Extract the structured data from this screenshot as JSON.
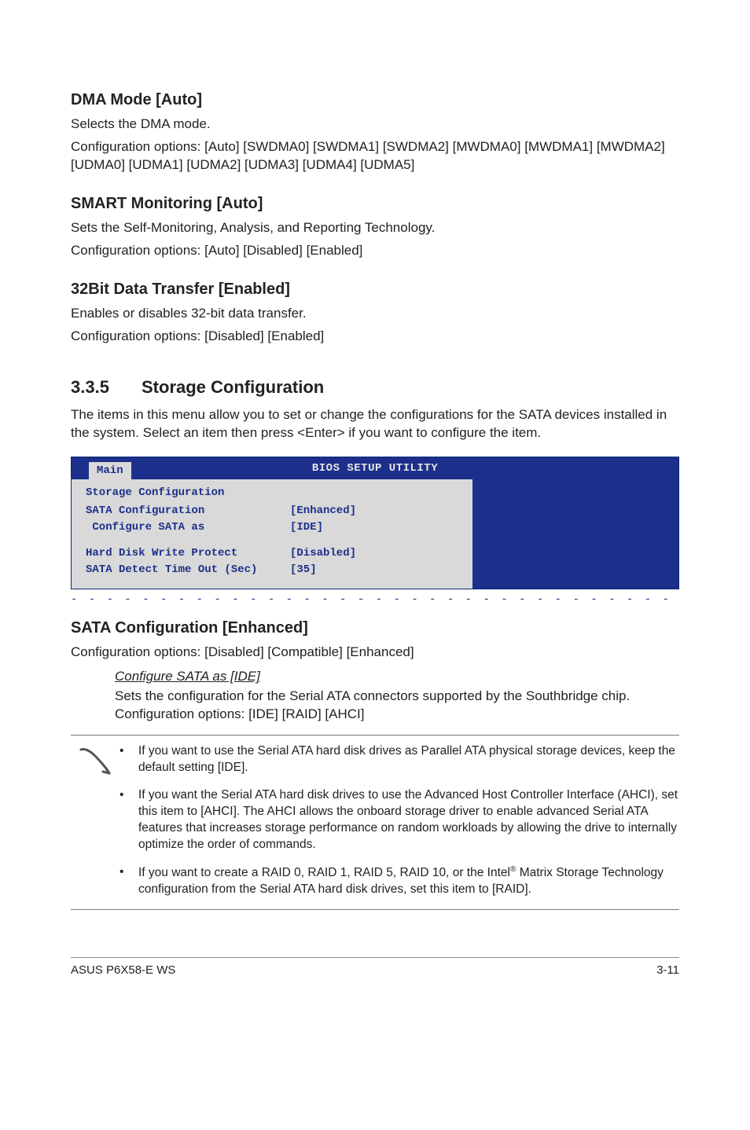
{
  "dma": {
    "heading": "DMA Mode [Auto]",
    "line1": "Selects the DMA mode.",
    "line2": "Configuration options: [Auto] [SWDMA0] [SWDMA1] [SWDMA2] [MWDMA0] [MWDMA1] [MWDMA2] [UDMA0] [UDMA1] [UDMA2] [UDMA3] [UDMA4] [UDMA5]"
  },
  "smart": {
    "heading": "SMART Monitoring [Auto]",
    "line1": "Sets the Self-Monitoring, Analysis, and Reporting Technology.",
    "line2": "Configuration options: [Auto] [Disabled] [Enabled]"
  },
  "bit32": {
    "heading": "32Bit Data Transfer [Enabled]",
    "line1": "Enables or disables 32-bit data transfer.",
    "line2": "Configuration options: [Disabled] [Enabled]"
  },
  "storage": {
    "num": "3.3.5",
    "title": "Storage Configuration",
    "intro": "The items in this menu allow you to set or change the configurations for the SATA devices installed in the system. Select an item then press <Enter> if you want to configure the item."
  },
  "bios": {
    "utility_title": "BIOS SETUP UTILITY",
    "tab": "Main",
    "group": "Storage Configuration",
    "rows": [
      {
        "label": "SATA Configuration",
        "value": "[Enhanced]"
      },
      {
        "label": " Configure SATA as",
        "value": "[IDE]"
      }
    ],
    "rows2": [
      {
        "label": "Hard Disk Write Protect",
        "value": "[Disabled]"
      },
      {
        "label": "SATA Detect Time Out (Sec)",
        "value": "[35]"
      }
    ]
  },
  "sata_conf": {
    "heading": "SATA Configuration [Enhanced]",
    "line1": "Configuration options: [Disabled] [Compatible] [Enhanced]",
    "sub_head": "Configure SATA as [IDE]",
    "sub_body": "Sets the configuration for the Serial ATA connectors supported by the Southbridge chip. Configuration options: [IDE] [RAID] [AHCI]"
  },
  "notes": {
    "n1": "If you want to use the Serial ATA hard disk drives as Parallel ATA physical storage devices, keep the default setting [IDE].",
    "n2": "If you want the Serial ATA hard disk drives to use the Advanced Host Controller Interface (AHCI), set this item to [AHCI]. The AHCI allows the onboard storage driver to enable advanced Serial ATA features that increases storage performance on random workloads by allowing the drive to internally optimize the order of commands.",
    "n3a": "If you want to create a RAID 0, RAID 1, RAID 5, RAID 10, or the Intel",
    "n3b": " Matrix Storage Technology configuration from the Serial ATA hard disk drives, set this item to [RAID]."
  },
  "footer": {
    "left": "ASUS P6X58-E WS",
    "right": "3-11"
  },
  "dash_row": "- - - - - - - - - - - - - - - - - - - - - - - - - - - - - - - - - - - - - - -"
}
